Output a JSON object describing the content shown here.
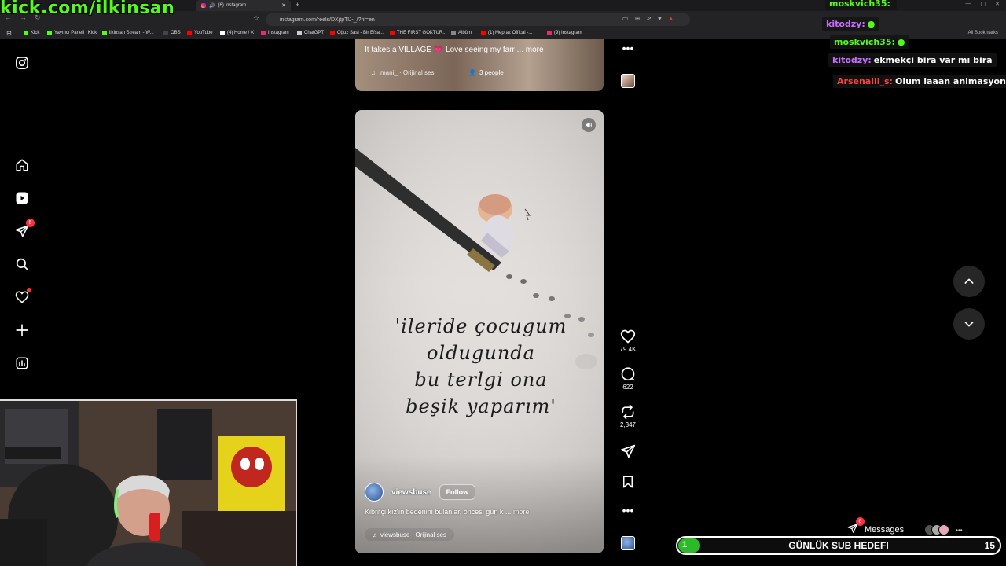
{
  "overlay": {
    "kick_channel": "kick.com/ilkinsan"
  },
  "browser": {
    "tab_title": "(6) Instagram",
    "new_tab": "+",
    "url": "instagram.com/reels/DXjtpTlJ-_/?hl=en",
    "all_bookmarks": "All Bookmarks",
    "bookmarks": [
      {
        "label": "Kick",
        "color": "#53fc18"
      },
      {
        "label": "Yayıncı Paneli | Kick",
        "color": "#53fc18"
      },
      {
        "label": "ilkinsan Stream - W...",
        "color": "#53fc18"
      },
      {
        "label": "OBS",
        "color": "#444444"
      },
      {
        "label": "YouTube",
        "color": "#ff0000"
      },
      {
        "label": "(4) Home / X",
        "color": "#ffffff"
      },
      {
        "label": "Instagram",
        "color": "#e1306c"
      },
      {
        "label": "ChatGPT",
        "color": "#cccccc"
      },
      {
        "label": "Oğuz Sasi - Bir Efsa...",
        "color": "#ff0000"
      },
      {
        "label": "THE FIRST GOKTUR...",
        "color": "#ff0000"
      },
      {
        "label": "Albüm",
        "color": "#888888"
      },
      {
        "label": "(1) Mepraz Offical -...",
        "color": "#ff0000"
      },
      {
        "label": "(9) Instagram",
        "color": "#e1306c"
      }
    ]
  },
  "nav": {
    "notification_count": "6"
  },
  "prev_reel": {
    "caption": "It takes a VILLAGE 💗 Love seeing my farr ... more",
    "audio": "mani_ · Orijinal ses",
    "people": "3 people"
  },
  "reel": {
    "quote_lines": [
      "'ileride çocugum",
      "oldugunda",
      "bu terlgi ona",
      "beşik yaparım'"
    ],
    "username": "viewsbuse",
    "follow": "Follow",
    "caption": "Kibritçi kız'ın bedenini bulanlar, öncesi gün k ...",
    "caption_more": "more",
    "audio": "viewsbuse · Orijinal ses"
  },
  "actions": {
    "likes": "79.4K",
    "comments": "622",
    "reposts": "2,347"
  },
  "chat": [
    {
      "user": "moskvich35:",
      "message": "",
      "color": "#53fc18"
    },
    {
      "user": "kitodzy:",
      "message": "",
      "color": "#c86dff"
    },
    {
      "user": "moskvich35:",
      "message": "",
      "color": "#53fc18"
    },
    {
      "user": "kitodzy:",
      "message": "ekmekçi bira var mı bira",
      "color": "#c86dff"
    },
    {
      "user": "Arsenalli_s:",
      "message": "Olum laaan animasyon çok güz",
      "color": "#ff4040"
    }
  ],
  "messages": {
    "label": "Messages",
    "count": "6"
  },
  "sub_goal": {
    "title": "GÜNLÜK SUB HEDEFI",
    "current": "1",
    "target": "15",
    "progress": 0.0667
  }
}
